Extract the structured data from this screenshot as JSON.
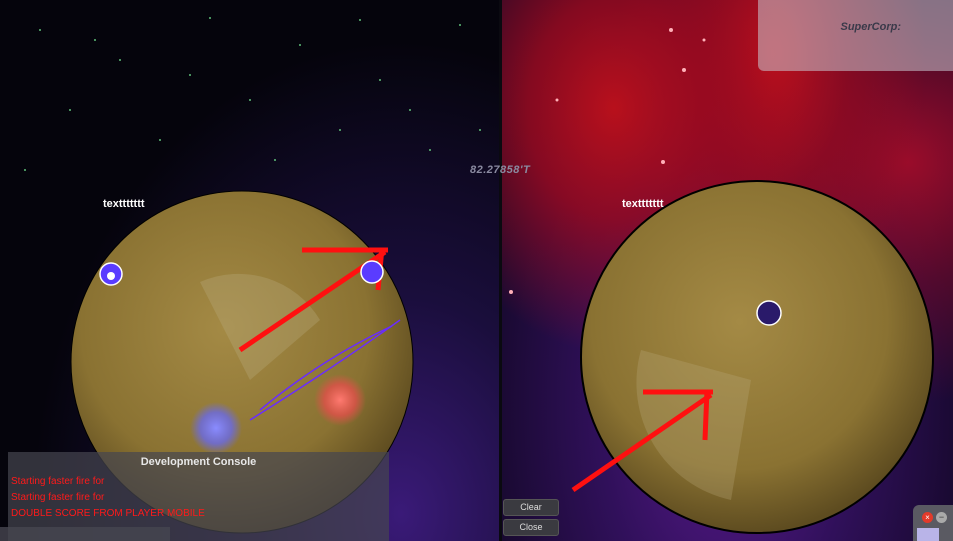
{
  "players": {
    "left_label": "texttttttt",
    "right_label": "texttttttt"
  },
  "hud": {
    "timer": "82.27858'T",
    "corp_name": "SuperCorp:"
  },
  "console": {
    "title": "Development Console",
    "lines": [
      "Starting faster fire for",
      "Starting faster fire for",
      "DOUBLE SCORE FROM PLAYER MOBILE"
    ],
    "clear_label": "Clear",
    "close_label": "Close"
  },
  "window_controls": {
    "close_glyph": "×",
    "min_glyph": "−"
  },
  "colors": {
    "planet": "#8d7532",
    "arrow": "#ff1010",
    "console_text": "#ff1a1a",
    "trail": "#6a2cff"
  }
}
